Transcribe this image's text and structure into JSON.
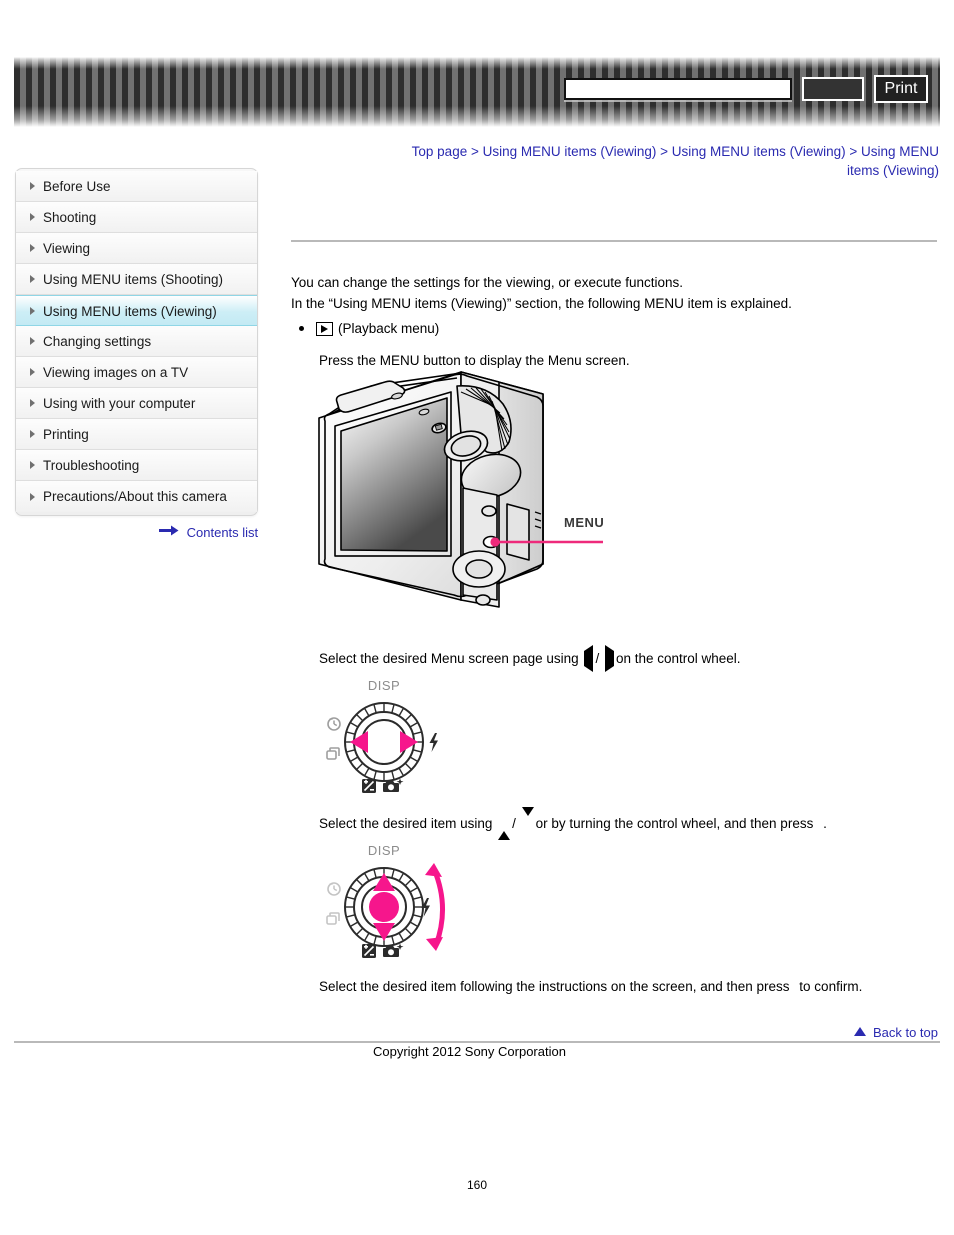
{
  "header": {
    "search": {
      "value": "",
      "placeholder": ""
    },
    "search_button_label": "",
    "print_button_label": "Print"
  },
  "breadcrumb": {
    "items": [
      "Top page",
      "Using MENU items (Viewing)",
      "Using MENU items (Viewing)",
      "Using MENU items (Viewing)"
    ],
    "separator": ">"
  },
  "sidebar": {
    "items": [
      {
        "label": "Before Use",
        "selected": false
      },
      {
        "label": "Shooting",
        "selected": false
      },
      {
        "label": "Viewing",
        "selected": false
      },
      {
        "label": "Using MENU items (Shooting)",
        "selected": false
      },
      {
        "label": "Using MENU items (Viewing)",
        "selected": true
      },
      {
        "label": "Changing settings",
        "selected": false
      },
      {
        "label": "Viewing images on a TV",
        "selected": false
      },
      {
        "label": "Using with your computer",
        "selected": false
      },
      {
        "label": "Printing",
        "selected": false
      },
      {
        "label": "Troubleshooting",
        "selected": false
      },
      {
        "label": "Precautions/About this camera",
        "selected": false
      }
    ],
    "contents_list_label": "Contents list"
  },
  "main": {
    "intro_line_1": "You can change the settings for the viewing, or execute functions.",
    "intro_line_2": "In the “Using MENU items (Viewing)” section, the following MENU item is explained.",
    "bullet_label": "(Playback menu)",
    "step_0": "Press the MENU button to display the Menu screen.",
    "step_1_a": "Select the desired Menu screen page using",
    "step_1_sep": "/",
    "step_1_b": "on the control wheel.",
    "step_2_a": "Select the desired item using",
    "step_2_sep": "/",
    "step_2_b": "or by turning the control wheel, and then press",
    "step_2_c": ".",
    "step_3_a": "Select the desired item following the instructions on the screen, and then press",
    "step_3_b": "to confirm.",
    "camera_callout_label": "MENU",
    "wheel_labels": {
      "top": "DISP",
      "right": "flash-icon",
      "left_upper": "self-timer-icon",
      "left_lower": "burst-mode-icon",
      "bottom_left": "exposure-compensation-icon",
      "bottom_right": "photo-creativity-icon"
    }
  },
  "footer": {
    "back_to_top_label": "Back to top",
    "copyright": "Copyright 2012 Sony Corporation",
    "page_number": "160"
  },
  "colors": {
    "link": "#2a2ab0",
    "accent_pink": "#f5views",
    "callout_pink": "#ee2a7b",
    "selected_sidebar": "#c3eaf4",
    "rule": "#b9b9b9"
  }
}
